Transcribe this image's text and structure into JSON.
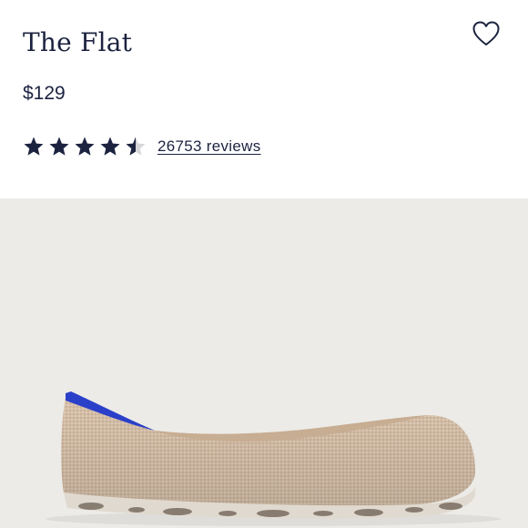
{
  "product": {
    "title": "The Flat",
    "price": "$129",
    "rating": 4.5,
    "rating_max": 5,
    "reviews_label": "26753 reviews"
  },
  "icons": {
    "favorite": "heart-outline-icon",
    "rating_star": "star-icon"
  },
  "colors": {
    "text": "#1c2340",
    "star": "#1c2340",
    "star_empty": "#d6d6da",
    "hero_background": "#ecebe7",
    "shoe_body": "#d8c2ac",
    "shoe_heel_accent": "#2b40c9"
  }
}
